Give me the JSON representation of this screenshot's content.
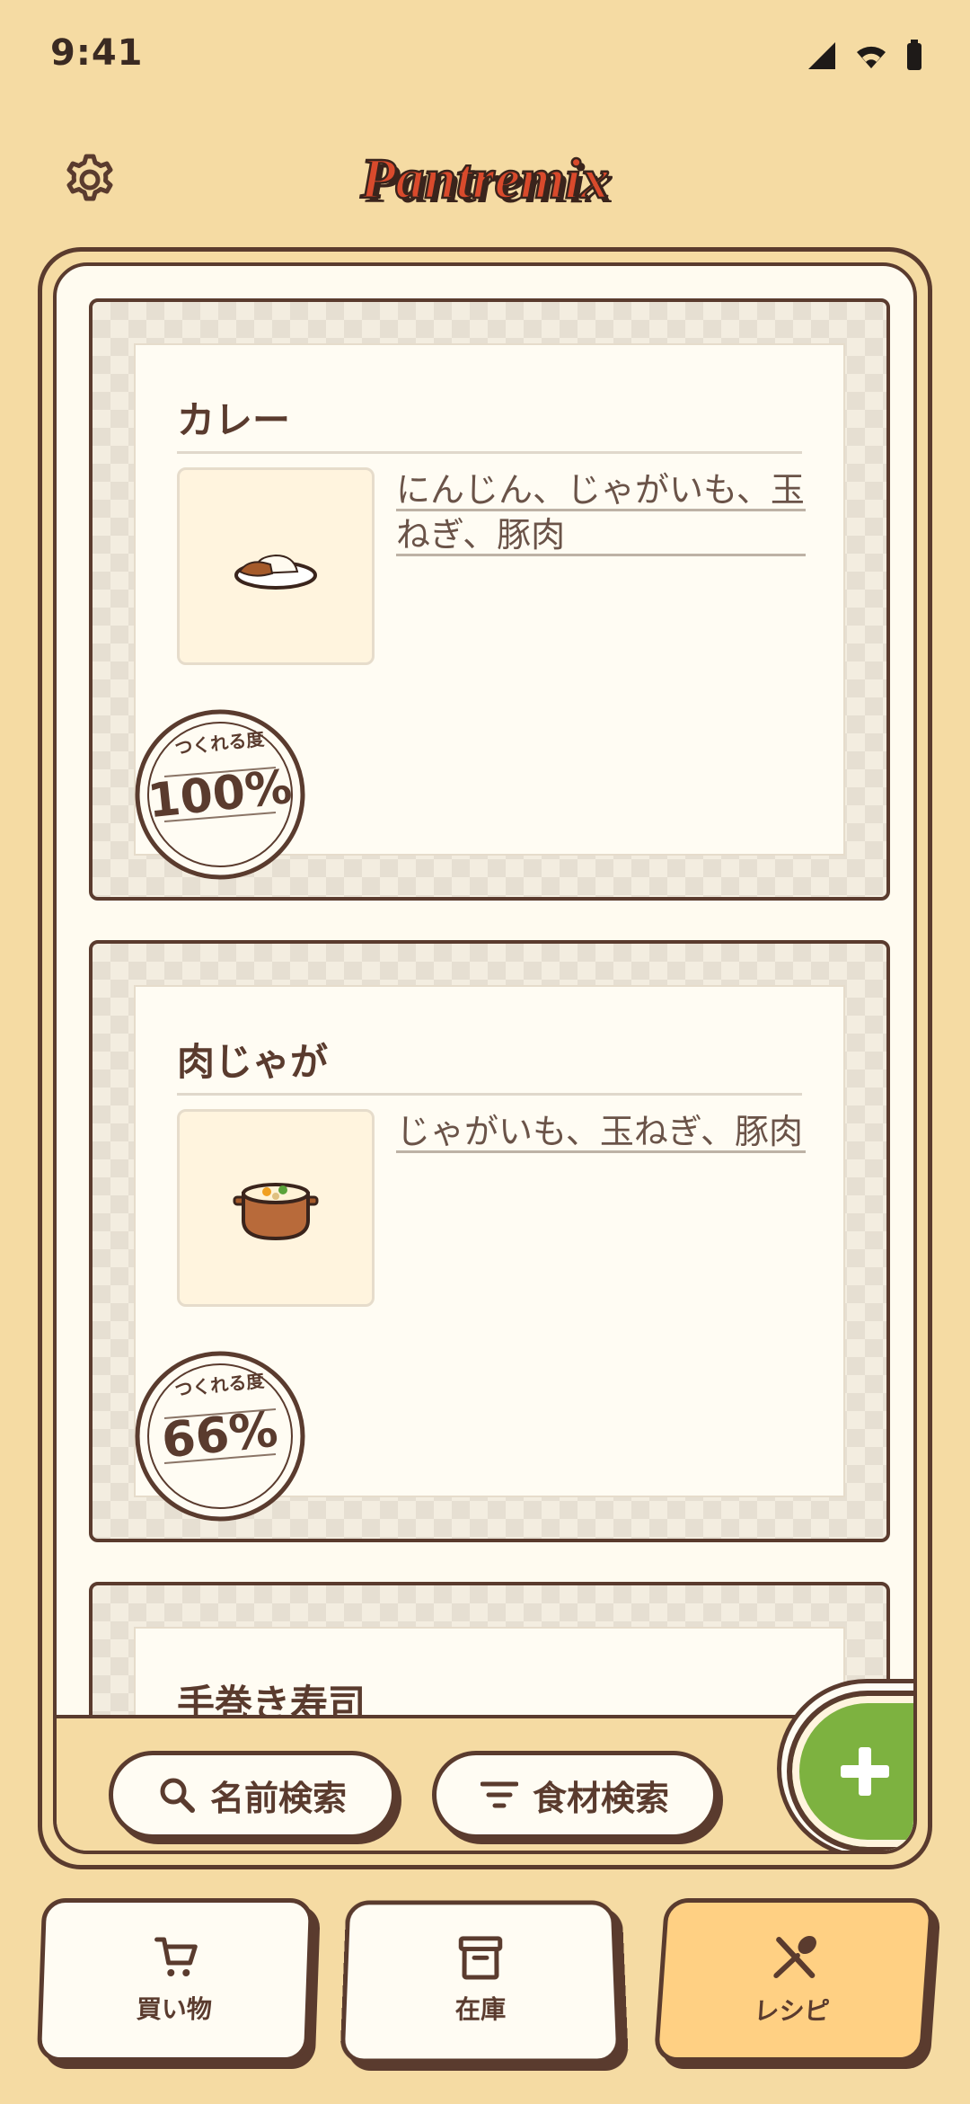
{
  "status_bar": {
    "time": "9:41"
  },
  "header": {
    "logo_text": "Pantremix"
  },
  "recipes": [
    {
      "title": "カレー",
      "ingredients": "にんじん、じゃがいも、玉ねぎ、豚肉",
      "image_icon": "curry-rice-icon",
      "stamp_label": "つくれる度",
      "percent": "100%"
    },
    {
      "title": "肉じゃが",
      "ingredients": "じゃがいも、玉ねぎ、豚肉",
      "image_icon": "stew-pot-icon",
      "stamp_label": "つくれる度",
      "percent": "66%"
    },
    {
      "title": "手巻き寿司"
    }
  ],
  "search": {
    "name_search_label": "名前検索",
    "ingredient_search_label": "食材検索"
  },
  "tabs": [
    {
      "label": "買い物",
      "icon": "cart-icon"
    },
    {
      "label": "在庫",
      "icon": "archive-icon"
    },
    {
      "label": "レシピ",
      "icon": "cutlery-icon",
      "active": true
    }
  ],
  "colors": {
    "background": "#f5dba3",
    "ink": "#5a3b2e",
    "paper": "#fffcf3",
    "accent_green": "#7db240",
    "active_tab": "#ffd083",
    "logo_red": "#d94a2c"
  }
}
